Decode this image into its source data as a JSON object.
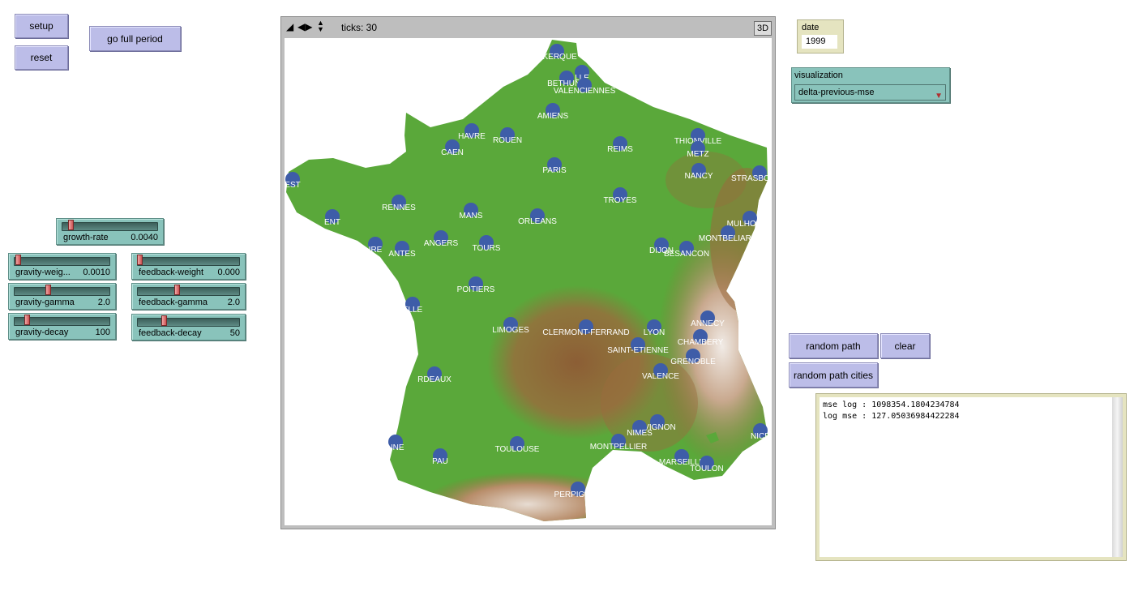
{
  "buttons": {
    "setup": "setup",
    "reset": "reset",
    "go_full_period": "go full period",
    "random_path": "random path",
    "clear": "clear",
    "random_path_cities": "random path cities"
  },
  "sliders": {
    "growth_rate": {
      "name": "growth-rate",
      "value": "0.0040",
      "level": 0.07
    },
    "gravity_weight": {
      "name": "gravity-weig...",
      "value": "0.0010",
      "level": 0.02
    },
    "gravity_gamma": {
      "name": "gravity-gamma",
      "value": "2.0",
      "level": 0.35
    },
    "gravity_decay": {
      "name": "gravity-decay",
      "value": "100",
      "level": 0.12
    },
    "feedback_weight": {
      "name": "feedback-weight",
      "value": "0.000",
      "level": 0.0
    },
    "feedback_gamma": {
      "name": "feedback-gamma",
      "value": "2.0",
      "level": 0.38
    },
    "feedback_decay": {
      "name": "feedback-decay",
      "value": "50",
      "level": 0.25
    }
  },
  "world": {
    "ticks_label": "ticks: 30",
    "btn_3d": "3D",
    "colors": {
      "lowland": "#5aa83a",
      "highland": "#9b6a3d",
      "peak": "#e8dfd8",
      "city": "#3e5da8"
    }
  },
  "cities": [
    {
      "name": "DUNKERQUE",
      "label": "NKERQUE"
    },
    {
      "name": "LILLE",
      "label": "LLE"
    },
    {
      "name": "BETHUNE",
      "label": "BETHUNE"
    },
    {
      "name": "VALENCIENNES",
      "label": "VALENCIENNES"
    },
    {
      "name": "AMIENS",
      "label": "AMIENS"
    },
    {
      "name": "LE HAVRE",
      "label": "HAVRE"
    },
    {
      "name": "ROUEN",
      "label": "ROUEN"
    },
    {
      "name": "CAEN",
      "label": "CAEN"
    },
    {
      "name": "REIMS",
      "label": "REIMS"
    },
    {
      "name": "THIONVILLE",
      "label": "THIONVILLE"
    },
    {
      "name": "METZ",
      "label": "METZ"
    },
    {
      "name": "PARIS",
      "label": "PARIS"
    },
    {
      "name": "NANCY",
      "label": "NANCY"
    },
    {
      "name": "STRASBOURG",
      "label": "STRASBOURG"
    },
    {
      "name": "BREST",
      "label": "EST"
    },
    {
      "name": "RENNES",
      "label": "RENNES"
    },
    {
      "name": "TROYES",
      "label": "TROYES"
    },
    {
      "name": "LE MANS",
      "label": "MANS"
    },
    {
      "name": "ORLEANS",
      "label": "ORLEANS"
    },
    {
      "name": "LORIENT",
      "label": "ENT"
    },
    {
      "name": "MULHOUSE",
      "label": "MULHOUSE"
    },
    {
      "name": "MONTBELIARD",
      "label": "MONTBELIARD"
    },
    {
      "name": "ANGERS",
      "label": "ANGERS"
    },
    {
      "name": "SAINT-NAZAIRE",
      "label": "IRE"
    },
    {
      "name": "NANTES",
      "label": "ANTES"
    },
    {
      "name": "TOURS",
      "label": "TOURS"
    },
    {
      "name": "DIJON",
      "label": "DIJON"
    },
    {
      "name": "BESANCON",
      "label": "BESANCON"
    },
    {
      "name": "POITIERS",
      "label": "POITIERS"
    },
    {
      "name": "LA ROCHELLE",
      "label": "ELLE"
    },
    {
      "name": "ANNECY",
      "label": "ANNECY"
    },
    {
      "name": "LIMOGES",
      "label": "LIMOGES"
    },
    {
      "name": "CLERMONT-FERRAND",
      "label": "CLERMONT-FERRAND"
    },
    {
      "name": "LYON",
      "label": "LYON"
    },
    {
      "name": "CHAMBERY",
      "label": "CHAMBERY"
    },
    {
      "name": "SAINT-ETIENNE",
      "label": "SAINT-ETIENNE"
    },
    {
      "name": "GRENOBLE",
      "label": "GRENOBLE"
    },
    {
      "name": "VALENCE",
      "label": "VALENCE"
    },
    {
      "name": "BORDEAUX",
      "label": "RDEAUX"
    },
    {
      "name": "AVIGNON",
      "label": "AVIGNON"
    },
    {
      "name": "NIMES",
      "label": "NIMES"
    },
    {
      "name": "NICE",
      "label": "NICE"
    },
    {
      "name": "BAYONNE",
      "label": "NNE"
    },
    {
      "name": "TOULOUSE",
      "label": "TOULOUSE"
    },
    {
      "name": "MONTPELLIER",
      "label": "MONTPELLIER"
    },
    {
      "name": "PAU",
      "label": "PAU"
    },
    {
      "name": "MARSEILLE",
      "label": "MARSEILLE"
    },
    {
      "name": "TOULON",
      "label": "TOULON"
    },
    {
      "name": "PERPIGNAN",
      "label": "PERPIGNAN"
    }
  ],
  "monitor": {
    "title": "date",
    "value": "1999"
  },
  "chooser": {
    "title": "visualization",
    "selected": "delta-previous-mse"
  },
  "output": {
    "lines": [
      "mse log : 1098354.1804234784",
      "log mse : 127.05036984422284"
    ]
  }
}
